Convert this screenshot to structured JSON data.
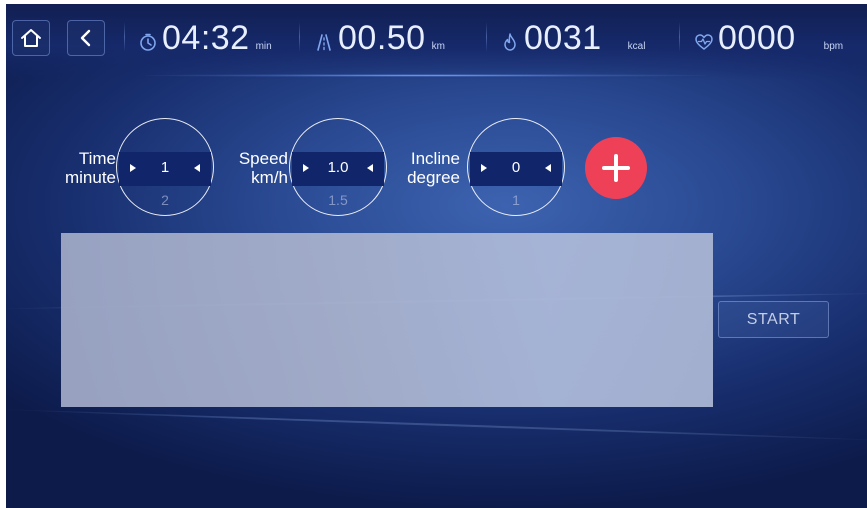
{
  "colors": {
    "background": "#1c357c",
    "accent_red": "#ee4158",
    "panel": "#a6b0cc",
    "text": "#ffffff"
  },
  "topbar": {
    "home_icon": "home-icon",
    "back_icon": "chevron-left-icon",
    "time": {
      "icon": "stopwatch-icon",
      "value": "04:32",
      "unit": "min"
    },
    "distance": {
      "icon": "road-icon",
      "value": "00.50",
      "unit": "km"
    },
    "calories": {
      "icon": "flame-icon",
      "value": "0031",
      "unit": "kcal"
    },
    "heart_rate": {
      "icon": "heart-pulse-icon",
      "value": "0000",
      "unit": "bpm"
    }
  },
  "params": {
    "time": {
      "label_line1": "Time",
      "label_line2": "minute",
      "value": "1",
      "next": "2"
    },
    "speed": {
      "label_line1": "Speed",
      "label_line2": "km/h",
      "value": "1.0",
      "next": "1.5"
    },
    "incline": {
      "label_line1": "Incline",
      "label_line2": "degree",
      "value": "0",
      "next": "1"
    },
    "add_icon": "plus-icon"
  },
  "start_label": "START"
}
